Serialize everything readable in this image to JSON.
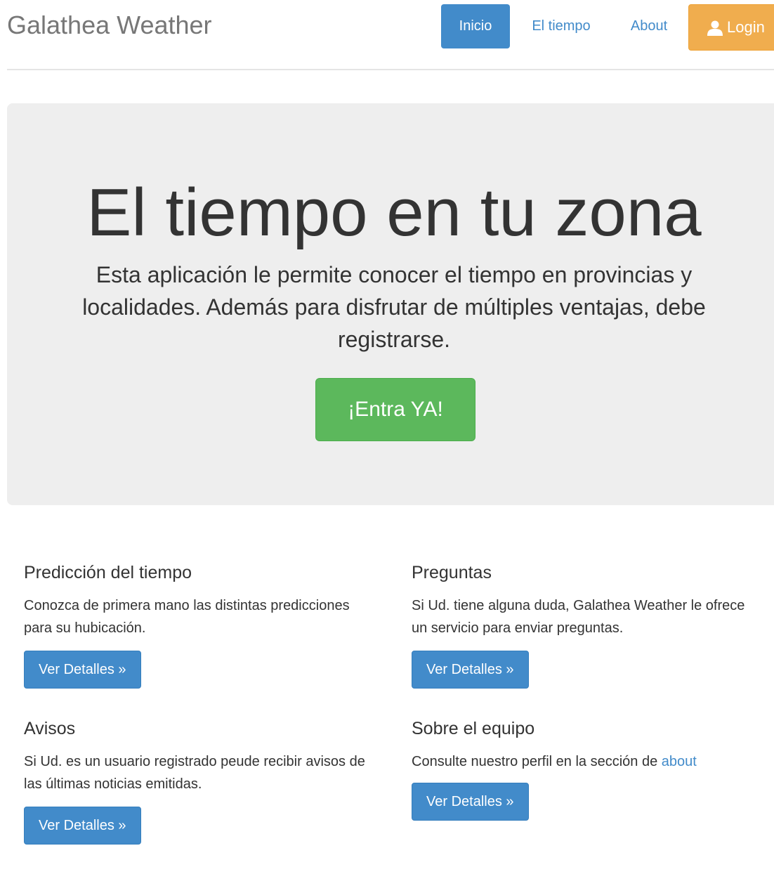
{
  "header": {
    "brand": "Galathea Weather",
    "nav": {
      "inicio": "Inicio",
      "tiempo": "El tiempo",
      "about": "About",
      "login": "Login"
    },
    "login_icon": "user-icon"
  },
  "jumbotron": {
    "title": "El tiempo en tu zona",
    "lead": "Esta aplicación le permite conocer el tiempo en provincias y localidades. Además para disfrutar de múltiples ventajas, debe registrarse.",
    "cta": "¡Entra YA!"
  },
  "features": {
    "prediccion": {
      "title": "Predicción del tiempo",
      "text": "Conozca de primera mano las distintas predicciones para su hubicación.",
      "button": "Ver Detalles »"
    },
    "preguntas": {
      "title": "Preguntas",
      "text": "Si Ud. tiene alguna duda, Galathea Weather le ofrece un servicio para enviar preguntas.",
      "button": "Ver Detalles »"
    },
    "avisos": {
      "title": "Avisos",
      "text": "Si Ud. es un usuario registrado peude recibir avisos de las últimas noticias emitidas.",
      "button": "Ver Detalles »"
    },
    "equipo": {
      "title": "Sobre el equipo",
      "text": "Consulte nuestro perfil en la sección de ",
      "link": "about",
      "button": "Ver Detalles »"
    }
  },
  "colors": {
    "primary": "#428bca",
    "success": "#5cb85c",
    "warning": "#f0ad4e",
    "jumbotron_bg": "#eeeeee",
    "brand_text": "#777777"
  }
}
